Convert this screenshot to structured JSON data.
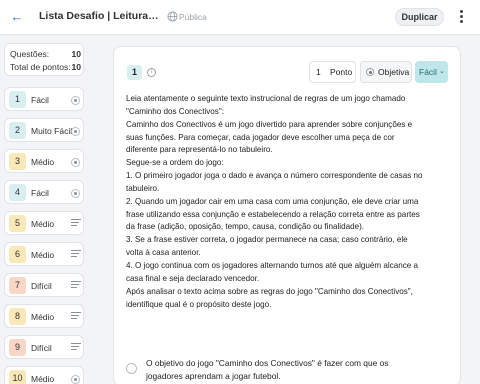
{
  "header": {
    "title": "Lista Desafio | Leitura e Co...",
    "visibility": "Pública",
    "duplicate_label": "Duplicar"
  },
  "summary": {
    "questions_label": "Questões:",
    "questions_value": "10",
    "points_label": "Total de pontos:",
    "points_value": "10"
  },
  "questions": [
    {
      "num": "1",
      "level": "Fácil",
      "icon": "radio-icon"
    },
    {
      "num": "2",
      "level": "Muito Fácil",
      "icon": "radio-icon"
    },
    {
      "num": "3",
      "level": "Médio",
      "icon": "radio-icon"
    },
    {
      "num": "4",
      "level": "Fácil",
      "icon": "radio-icon"
    },
    {
      "num": "5",
      "level": "Médio",
      "icon": "lines-icon"
    },
    {
      "num": "6",
      "level": "Médio",
      "icon": "lines-icon"
    },
    {
      "num": "7",
      "level": "Difícil",
      "icon": "lines-icon"
    },
    {
      "num": "8",
      "level": "Médio",
      "icon": "lines-icon"
    },
    {
      "num": "9",
      "level": "Difícil",
      "icon": "lines-icon"
    },
    {
      "num": "10",
      "level": "Médio",
      "icon": "radio-icon"
    }
  ],
  "card": {
    "number": "1",
    "points_value": "1",
    "points_label": "Ponto",
    "type_label": "Objetiva",
    "difficulty": "Fácil",
    "paragraphs": [
      "Leia atentamente o seguinte texto instrucional de regras de um jogo chamado \"Caminho dos Conectivos\":",
      "",
      "Caminho dos Conectivos é um jogo divertido para aprender sobre conjunções e suas funções. Para começar, cada jogador deve escolher uma peça de cor diferente para representá-lo no tabuleiro.",
      "Segue-se a ordem do jogo:",
      "",
      "1. O primeiro jogador joga o dado e avança o número correspondente de casas no tabuleiro.",
      "2. Quando um jogador cair em uma casa com uma conjunção, ele deve criar uma frase utilizando essa conjunção e estabelecendo a relação correta entre as partes da frase (adição, oposição, tempo, causa, condição ou finalidade).",
      "3. Se a frase estiver correta, o jogador permanece na casa; caso contrário, ele volta à casa anterior.",
      "4. O jogo continua com os jogadores alternando turnos até que alguém alcance a casa final e seja declarado vencedor.",
      "",
      "Após analisar o texto acima sobre as regras do jogo \"Caminho dos Conectivos\", identifique qual é o propósito deste jogo."
    ],
    "option_a": "O objetivo do jogo \"Caminho dos Conectivos\" é fazer com que os jogadores aprendam a jogar futebol."
  },
  "colors": {
    "accent": "#2f6fd6",
    "easy": "#d8eef0",
    "medium": "#fbe8b8",
    "hard": "#f9d6c6",
    "difficulty_chip": "#bfe6e8"
  }
}
